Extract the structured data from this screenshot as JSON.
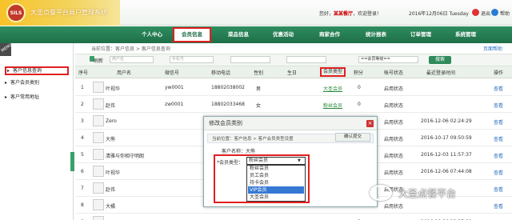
{
  "header": {
    "app_title": "大圣点餐平台商户管理系统",
    "logo_text": "SILS",
    "welcome_prefix": "您好，",
    "shop_name": "某某餐厅",
    "welcome_suffix": "，欢迎登录！",
    "date": "2016年12月06日 Tuesday",
    "exit_label": "退出",
    "help_label": "帮助"
  },
  "nav": {
    "items": [
      "个人中心",
      "会员信息",
      "菜品信息",
      "优惠活动",
      "商家合作",
      "统计报表",
      "订单管理",
      "系统管理"
    ],
    "active_index": 1
  },
  "sidebar": {
    "menu_tab": "MENU",
    "items": [
      {
        "label": "客户信息查询",
        "active": true
      },
      {
        "label": "客户会员类别",
        "active": false
      },
      {
        "label": "客户常用地址",
        "active": false
      }
    ]
  },
  "content": {
    "breadcrumb": "当前位置：客户信息 > 客户信息查询",
    "help_link": "页面帮助",
    "refresh_label": "刷新",
    "username_placeholder": "用户名",
    "phone_placeholder": "手机号",
    "level_select": "==会员等级==",
    "search_label": "搜索",
    "columns": [
      "序号",
      "用户名",
      "微信号",
      "移动电话",
      "性别",
      "生日",
      "会员类型",
      "积分",
      "帐号状态",
      "最近登录时间",
      "操作"
    ],
    "rows": [
      {
        "no": "1",
        "name": "叶视华",
        "wechat": "yw0001",
        "phone": "18802038002",
        "gender": "男",
        "birthday": "",
        "type": "大圣会员",
        "points": "0",
        "status": "启用状态",
        "last_login": "",
        "op": "查看"
      },
      {
        "no": "2",
        "name": "赵伟",
        "wechat": "zw0001",
        "phone": "18802033468",
        "gender": "女",
        "birthday": "",
        "type": "粉丝会员",
        "points": "0",
        "status": "启用状态",
        "last_login": "",
        "op": "查看"
      },
      {
        "no": "3",
        "name": "Zero",
        "wechat": "",
        "phone": "",
        "gender": "",
        "birthday": "",
        "type": "",
        "points": "0",
        "status": "启用状态",
        "last_login": "2016-12-06 02:24:29",
        "op": "查看"
      },
      {
        "no": "4",
        "name": "大熊",
        "wechat": "",
        "phone": "",
        "gender": "",
        "birthday": "",
        "type": "",
        "points": "0",
        "status": "启用状态",
        "last_login": "2016-10-17 09:50:59",
        "op": "查看"
      },
      {
        "no": "5",
        "name": "清雅与你相守明朗",
        "wechat": "",
        "phone": "",
        "gender": "",
        "birthday": "",
        "type": "",
        "points": "0",
        "status": "启用状态",
        "last_login": "2016-12-03 11:57:37",
        "op": "查看"
      },
      {
        "no": "6",
        "name": "叶视华",
        "wechat": "",
        "phone": "",
        "gender": "",
        "birthday": "",
        "type": "",
        "points": "0",
        "status": "启用状态",
        "last_login": "2016-12-06 07:44:08",
        "op": "查看"
      },
      {
        "no": "7",
        "name": "赵伟",
        "wechat": "",
        "phone": "",
        "gender": "",
        "birthday": "",
        "type": "",
        "points": "0",
        "status": "启用状态",
        "last_login": "",
        "op": "查看"
      },
      {
        "no": "8",
        "name": "大橘",
        "wechat": "",
        "phone": "",
        "gender": "",
        "birthday": "",
        "type": "",
        "points": "0",
        "status": "启用状态",
        "last_login": "",
        "op": "查看"
      },
      {
        "no": "9",
        "name": "彦文",
        "wechat": "",
        "phone": "",
        "gender": "",
        "birthday": "",
        "type": "粉丝会员",
        "points": "0",
        "status": "启用状态",
        "last_login": "2016-08-30 23:35:38",
        "op": "查看"
      }
    ]
  },
  "dialog": {
    "title": "修改会员类别",
    "close": "×",
    "breadcrumb": "当前位置：客户信息 > 客户会员类型设置",
    "save_label": "确认提交",
    "customer_name_label": "客户名称：大熊",
    "type_label": "*会员类型：",
    "selected": "粉丝会员",
    "options": [
      "粉丝会员",
      "员工会员",
      "持卡会员",
      "VIP会员",
      "大圣会员"
    ],
    "highlight_index": 3
  },
  "watermark": "大圣点餐平台"
}
